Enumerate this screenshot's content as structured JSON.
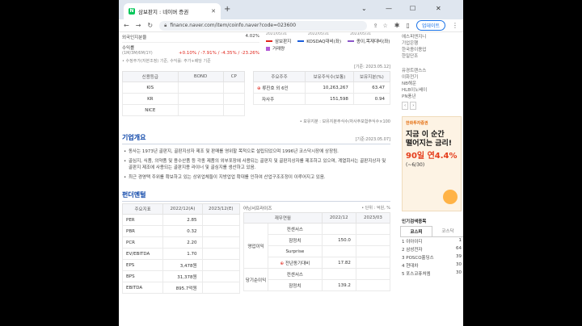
{
  "browser": {
    "tab_title": "삼보판지 : 네이버 증권",
    "url": "finance.naver.com/item/coinfo.naver?code=023600",
    "update_label": "업데이트",
    "favicon_letter": "N"
  },
  "top": {
    "foreign_label": "외국인지분율",
    "foreign_value": "4.02%",
    "return_label": "수익률",
    "return_periods": "(1M/3M/6M/1Y)",
    "return_values": "+0.10% / -7.91% / -4.35% / -23.26%",
    "note": "• 수정주가(자본조정) 기준, 수익률: 주가+배당 기준"
  },
  "chart_legend": {
    "dates": [
      "2021/05/31",
      "2022/05/31",
      "2023/05/31"
    ],
    "items": [
      {
        "label": "삼보판지",
        "color": "#e0251b"
      },
      {
        "label": "KOSDAQ대비(좌)",
        "color": "#1b5edb"
      },
      {
        "label": "종이,목재대비(좌)",
        "color": "#8a56c9"
      },
      {
        "label": "거래량",
        "color": "#b35bd6"
      }
    ]
  },
  "credit": {
    "headers": [
      "신용등급",
      "BOND",
      "CP"
    ],
    "rows": [
      "KIS",
      "KR",
      "NICE"
    ]
  },
  "shareholders": {
    "date_note": "[기준: 2023.05.12]",
    "headers": [
      "주요주주",
      "보유주식수(보통)",
      "보유지분(%)"
    ],
    "rows": [
      {
        "name": "류진호 외 6인",
        "shares": "10,263,267",
        "pct": "63.47"
      },
      {
        "name": "자사주",
        "shares": "151,598",
        "pct": "0.94"
      }
    ],
    "footnote": "• 보유지분 : 보유지분주식수/자사주포함주식수×100"
  },
  "company": {
    "title": "기업개요",
    "date_note": "[기준:2023.05.07]",
    "bullets": [
      "동사는 1973년 골판지, 골판지상자 제조 및 판매를 영위할 목적으로 설립되었으며 1996년 코스닥시장에 상장됨.",
      "골심지, 식품, 의약품 및 용수산품 등 각종 제품의 외부포장에 사용되는 골판지 및 골판지상자를 제조하고 있으며, 계열회사는 골판지상자 및 골판지 제조에 사용되는 골판지용 라이너 및 골심지를 생산하고 있음.",
      "최근 경영택 주위를 확보하고 있는 상위업체들이 지방업업 확대를 인하여 산업구조조정이 이루어지고 있음."
    ]
  },
  "fundamental": {
    "title": "펀더멘털",
    "unit_note": "• 단위 : 억원, %",
    "left_headers": [
      "주요지표",
      "2022/12(A)",
      "2023/12(E)"
    ],
    "left_rows": [
      {
        "label": "PER",
        "a": "2.85",
        "e": ""
      },
      {
        "label": "PBR",
        "a": "0.32",
        "e": ""
      },
      {
        "label": "PCR",
        "a": "2.20",
        "e": ""
      },
      {
        "label": "EV/EBITDA",
        "a": "1.70",
        "e": ""
      },
      {
        "label": "EPS",
        "a": "3,478원",
        "e": ""
      },
      {
        "label": "BPS",
        "a": "31,378원",
        "e": ""
      },
      {
        "label": "EBITDA",
        "a": "895.7억원",
        "e": ""
      }
    ],
    "right_caption": "어닝서프라이즈",
    "right_headers": [
      "재무연월",
      "2022/12",
      "2023/03"
    ],
    "group_labels": [
      "영업이익",
      "당기순이익"
    ],
    "right_rows": [
      {
        "label": "컨센서스",
        "v1": "",
        "v2": ""
      },
      {
        "label": "잠정치",
        "v1": "150.0",
        "v2": ""
      },
      {
        "label": "Surprise",
        "v1": "",
        "v2": ""
      },
      {
        "label": "전년동기대비",
        "v1": "17.82",
        "v2": ""
      },
      {
        "label": "컨센서스",
        "v1": "",
        "v2": ""
      },
      {
        "label": "잠정치",
        "v1": "139.2",
        "v2": ""
      }
    ]
  },
  "right_panel": {
    "news_items": [
      "에스피엔지니",
      "기업은행",
      "한국종이용업",
      "한일단조"
    ],
    "related_items": [
      "유경트랜스스",
      "이화전기",
      "NB해운",
      "HLB이노베이",
      "PN풍년"
    ],
    "ad": {
      "logo": "한화투자증권",
      "line1": "지금 이 순간",
      "line2": "떨어지는 금리!",
      "rate": "90일 연4.4%",
      "period": "(~6/30)"
    },
    "trend_title": "인기검색종목",
    "trend_tab_active": "코스피",
    "trend_tab_other": "코스닥",
    "trend_items": [
      {
        "rank": "1",
        "name": "이아이디",
        "val": "1"
      },
      {
        "rank": "2",
        "name": "삼성전자",
        "val": "64"
      },
      {
        "rank": "3",
        "name": "POSCO홀딩스",
        "val": "39"
      },
      {
        "rank": "4",
        "name": "현대차",
        "val": "30"
      },
      {
        "rank": "5",
        "name": "포스코퓨처엠",
        "val": "30"
      }
    ]
  }
}
